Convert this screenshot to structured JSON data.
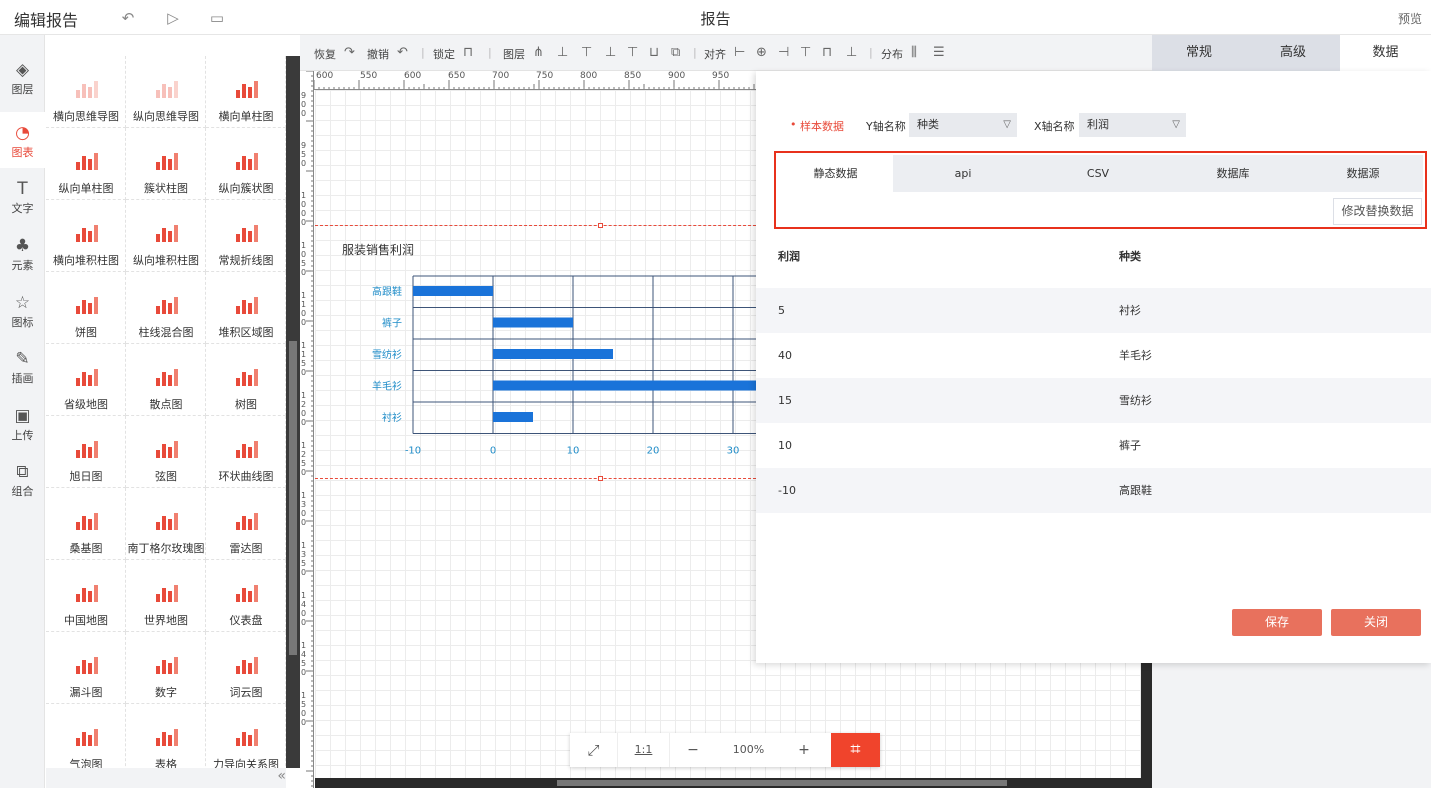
{
  "header": {
    "title": "编辑报告",
    "center_title": "报告",
    "preview_label": "预览"
  },
  "rail": [
    {
      "label": "图层",
      "icon": "layers-icon",
      "glyph": "◈"
    },
    {
      "label": "图表",
      "icon": "chart-icon",
      "glyph": "◔"
    },
    {
      "label": "文字",
      "icon": "text-icon",
      "glyph": "T"
    },
    {
      "label": "元素",
      "icon": "elements-icon",
      "glyph": "♣"
    },
    {
      "label": "图标",
      "icon": "star-icon",
      "glyph": "☆"
    },
    {
      "label": "插画",
      "icon": "palette-icon",
      "glyph": "✎"
    },
    {
      "label": "上传",
      "icon": "upload-image-icon",
      "glyph": "▣"
    },
    {
      "label": "组合",
      "icon": "group-icon",
      "glyph": "⧉"
    }
  ],
  "palette": [
    "横向思维导图",
    "纵向思维导图",
    "横向单柱图",
    "纵向单柱图",
    "簇状柱图",
    "纵向簇状图",
    "横向堆积柱图",
    "纵向堆积柱图",
    "常规折线图",
    "饼图",
    "柱线混合图",
    "堆积区域图",
    "省级地图",
    "散点图",
    "树图",
    "旭日图",
    "弦图",
    "环状曲线图",
    "桑基图",
    "南丁格尔玫瑰图",
    "雷达图",
    "中国地图",
    "世界地图",
    "仪表盘",
    "漏斗图",
    "数字",
    "词云图",
    "气泡图",
    "表格",
    "力导向关系图"
  ],
  "toolbar": {
    "restore": "恢复",
    "undo": "撤销",
    "lock": "锁定",
    "layer": "图层",
    "align": "对齐",
    "distribute": "分布"
  },
  "ruler": {
    "h_ticks": [
      "600",
      "550",
      "600",
      "650",
      "700",
      "750",
      "800",
      "850",
      "900",
      "950"
    ],
    "v_ticks": [
      "900",
      "950",
      "1000",
      "1050",
      "1100",
      "1150",
      "1200",
      "1250",
      "1300",
      "1350",
      "1400",
      "1450",
      "1500"
    ]
  },
  "right_tabs": [
    "常规",
    "高级",
    "数据"
  ],
  "dialog": {
    "sample_label": "样本数据",
    "y_axis_label": "Y轴名称",
    "y_axis_value": "种类",
    "x_axis_label": "X轴名称",
    "x_axis_value": "利润",
    "source_tabs": [
      "静态数据",
      "api",
      "CSV",
      "数据库",
      "数据源"
    ],
    "modify_button": "修改替换数据",
    "columns": [
      "利润",
      "种类"
    ],
    "rows": [
      [
        "5",
        "衬衫"
      ],
      [
        "40",
        "羊毛衫"
      ],
      [
        "15",
        "雪纺衫"
      ],
      [
        "10",
        "裤子"
      ],
      [
        "-10",
        "高跟鞋"
      ]
    ],
    "save": "保存",
    "close": "关闭"
  },
  "zoom": {
    "fit": "⤢",
    "ratio": "1:1",
    "minus": "−",
    "level": "100%",
    "plus": "+",
    "grid": "⌗"
  },
  "colors": {
    "accent": "#e84a3a",
    "bar": "#1a73d9",
    "axis_label": "#1f8cc8",
    "highlight_border": "#e8311c"
  },
  "chart_data": {
    "type": "bar",
    "orientation": "horizontal",
    "title": "服装销售利润",
    "categories": [
      "高跟鞋",
      "裤子",
      "雪纺衫",
      "羊毛衫",
      "衬衫"
    ],
    "values": [
      -10,
      10,
      15,
      40,
      5
    ],
    "x_ticks": [
      "-10",
      "0",
      "10",
      "20",
      "30"
    ],
    "xlim": [
      -10,
      40
    ],
    "grid": true
  }
}
